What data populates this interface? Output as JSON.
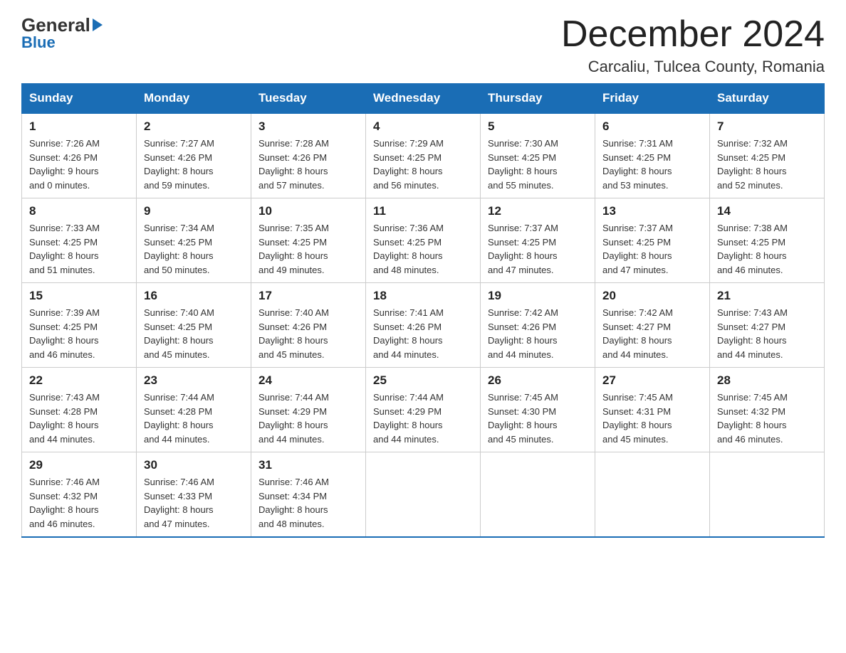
{
  "header": {
    "logo_general": "General",
    "logo_blue": "Blue",
    "month_title": "December 2024",
    "location": "Carcaliu, Tulcea County, Romania"
  },
  "weekdays": [
    "Sunday",
    "Monday",
    "Tuesday",
    "Wednesday",
    "Thursday",
    "Friday",
    "Saturday"
  ],
  "weeks": [
    [
      {
        "day": "1",
        "sunrise": "7:26 AM",
        "sunset": "4:26 PM",
        "daylight": "9 hours and 0 minutes."
      },
      {
        "day": "2",
        "sunrise": "7:27 AM",
        "sunset": "4:26 PM",
        "daylight": "8 hours and 59 minutes."
      },
      {
        "day": "3",
        "sunrise": "7:28 AM",
        "sunset": "4:26 PM",
        "daylight": "8 hours and 57 minutes."
      },
      {
        "day": "4",
        "sunrise": "7:29 AM",
        "sunset": "4:25 PM",
        "daylight": "8 hours and 56 minutes."
      },
      {
        "day": "5",
        "sunrise": "7:30 AM",
        "sunset": "4:25 PM",
        "daylight": "8 hours and 55 minutes."
      },
      {
        "day": "6",
        "sunrise": "7:31 AM",
        "sunset": "4:25 PM",
        "daylight": "8 hours and 53 minutes."
      },
      {
        "day": "7",
        "sunrise": "7:32 AM",
        "sunset": "4:25 PM",
        "daylight": "8 hours and 52 minutes."
      }
    ],
    [
      {
        "day": "8",
        "sunrise": "7:33 AM",
        "sunset": "4:25 PM",
        "daylight": "8 hours and 51 minutes."
      },
      {
        "day": "9",
        "sunrise": "7:34 AM",
        "sunset": "4:25 PM",
        "daylight": "8 hours and 50 minutes."
      },
      {
        "day": "10",
        "sunrise": "7:35 AM",
        "sunset": "4:25 PM",
        "daylight": "8 hours and 49 minutes."
      },
      {
        "day": "11",
        "sunrise": "7:36 AM",
        "sunset": "4:25 PM",
        "daylight": "8 hours and 48 minutes."
      },
      {
        "day": "12",
        "sunrise": "7:37 AM",
        "sunset": "4:25 PM",
        "daylight": "8 hours and 47 minutes."
      },
      {
        "day": "13",
        "sunrise": "7:37 AM",
        "sunset": "4:25 PM",
        "daylight": "8 hours and 47 minutes."
      },
      {
        "day": "14",
        "sunrise": "7:38 AM",
        "sunset": "4:25 PM",
        "daylight": "8 hours and 46 minutes."
      }
    ],
    [
      {
        "day": "15",
        "sunrise": "7:39 AM",
        "sunset": "4:25 PM",
        "daylight": "8 hours and 46 minutes."
      },
      {
        "day": "16",
        "sunrise": "7:40 AM",
        "sunset": "4:25 PM",
        "daylight": "8 hours and 45 minutes."
      },
      {
        "day": "17",
        "sunrise": "7:40 AM",
        "sunset": "4:26 PM",
        "daylight": "8 hours and 45 minutes."
      },
      {
        "day": "18",
        "sunrise": "7:41 AM",
        "sunset": "4:26 PM",
        "daylight": "8 hours and 44 minutes."
      },
      {
        "day": "19",
        "sunrise": "7:42 AM",
        "sunset": "4:26 PM",
        "daylight": "8 hours and 44 minutes."
      },
      {
        "day": "20",
        "sunrise": "7:42 AM",
        "sunset": "4:27 PM",
        "daylight": "8 hours and 44 minutes."
      },
      {
        "day": "21",
        "sunrise": "7:43 AM",
        "sunset": "4:27 PM",
        "daylight": "8 hours and 44 minutes."
      }
    ],
    [
      {
        "day": "22",
        "sunrise": "7:43 AM",
        "sunset": "4:28 PM",
        "daylight": "8 hours and 44 minutes."
      },
      {
        "day": "23",
        "sunrise": "7:44 AM",
        "sunset": "4:28 PM",
        "daylight": "8 hours and 44 minutes."
      },
      {
        "day": "24",
        "sunrise": "7:44 AM",
        "sunset": "4:29 PM",
        "daylight": "8 hours and 44 minutes."
      },
      {
        "day": "25",
        "sunrise": "7:44 AM",
        "sunset": "4:29 PM",
        "daylight": "8 hours and 44 minutes."
      },
      {
        "day": "26",
        "sunrise": "7:45 AM",
        "sunset": "4:30 PM",
        "daylight": "8 hours and 45 minutes."
      },
      {
        "day": "27",
        "sunrise": "7:45 AM",
        "sunset": "4:31 PM",
        "daylight": "8 hours and 45 minutes."
      },
      {
        "day": "28",
        "sunrise": "7:45 AM",
        "sunset": "4:32 PM",
        "daylight": "8 hours and 46 minutes."
      }
    ],
    [
      {
        "day": "29",
        "sunrise": "7:46 AM",
        "sunset": "4:32 PM",
        "daylight": "8 hours and 46 minutes."
      },
      {
        "day": "30",
        "sunrise": "7:46 AM",
        "sunset": "4:33 PM",
        "daylight": "8 hours and 47 minutes."
      },
      {
        "day": "31",
        "sunrise": "7:46 AM",
        "sunset": "4:34 PM",
        "daylight": "8 hours and 48 minutes."
      },
      null,
      null,
      null,
      null
    ]
  ]
}
